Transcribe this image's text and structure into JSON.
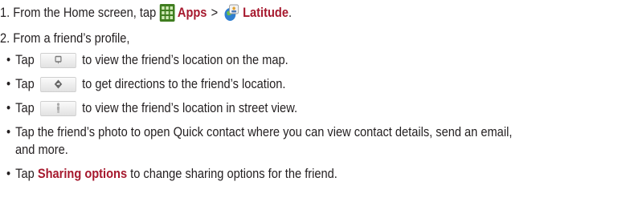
{
  "steps": [
    {
      "num": "1.",
      "pre": "From the Home screen, tap",
      "apps_label": "Apps",
      "separator": ">",
      "latitude_label": "Latitude",
      "post": "."
    },
    {
      "num": "2.",
      "text": "From a friend’s profile,"
    }
  ],
  "bullets": [
    {
      "tap": "Tap",
      "icon": "map-pin-icon",
      "text": "to view the friend’s location on the map."
    },
    {
      "tap": "Tap",
      "icon": "directions-icon",
      "text": "to get directions to the friend’s location."
    },
    {
      "tap": "Tap",
      "icon": "street-view-icon",
      "text": "to view the friend’s location in street view."
    },
    {
      "text": "Tap the friend’s photo to open Quick contact where you can view contact details, send an email,",
      "cont": "and more."
    },
    {
      "pre": "Tap",
      "link": "Sharing options",
      "post": "to change sharing options for the friend."
    }
  ],
  "bullet_char": "•",
  "colors": {
    "link": "#a6192e",
    "text": "#231f20"
  }
}
